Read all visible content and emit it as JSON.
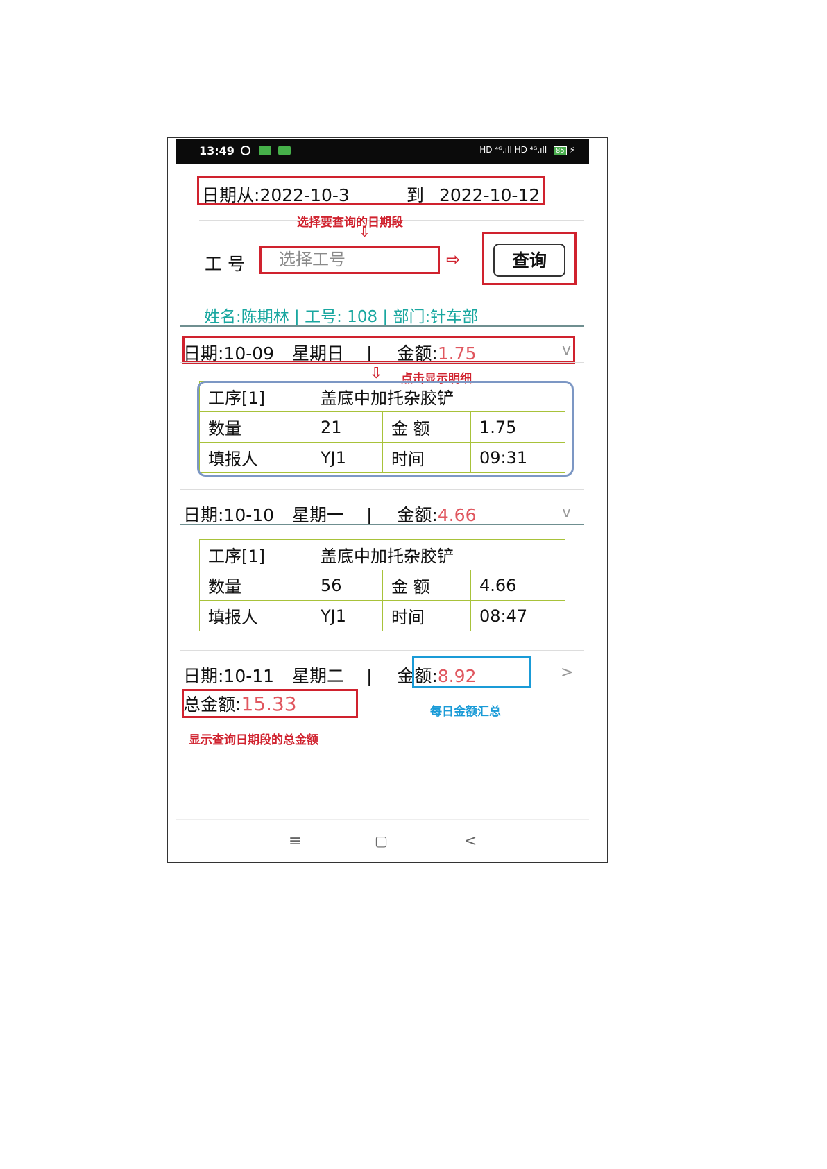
{
  "status_bar": {
    "time": "13:49",
    "signal": "HD ⁴ᴳ.ıll HD ⁴ᴳ.ıll",
    "battery": "85"
  },
  "date_range": {
    "from_label": "日期从:",
    "from": "2022-10-3",
    "to_label": "到",
    "to": "2022-10-12"
  },
  "annotations": {
    "select_date": "选择要查询的日期段",
    "click_detail": "点击显示明细",
    "daily_total": "每日金额汇总",
    "total_note": "显示查询日期段的总金额"
  },
  "employee": {
    "label": "工 号",
    "placeholder": "选择工号"
  },
  "query_button": "查询",
  "info": "姓名:陈期林 | 工号: 108 | 部门:针车部",
  "days": [
    {
      "date": "日期:10-09",
      "weekday": "星期日",
      "sep": "|",
      "amount_label": "金额:",
      "amount": "1.75",
      "chevron": "v"
    },
    {
      "date": "日期:10-10",
      "weekday": "星期一",
      "sep": "|",
      "amount_label": "金额:",
      "amount": "4.66",
      "chevron": "v"
    },
    {
      "date": "日期:10-11",
      "weekday": "星期二",
      "sep": "|",
      "amount_label": "金额:",
      "amount": "8.92",
      "chevron": ">"
    }
  ],
  "details": [
    {
      "process_label": "工序[1]",
      "process": "盖底中加托杂胶铲",
      "qty_label": "数量",
      "qty": "21",
      "amt_label": "金 额",
      "amt": "1.75",
      "reporter_label": "填报人",
      "reporter": "YJ1",
      "time_label": "时间",
      "time": "09:31"
    },
    {
      "process_label": "工序[1]",
      "process": "盖底中加托杂胶铲",
      "qty_label": "数量",
      "qty": "56",
      "amt_label": "金 额",
      "amt": "4.66",
      "reporter_label": "填报人",
      "reporter": "YJ1",
      "time_label": "时间",
      "time": "08:47"
    }
  ],
  "total": {
    "label": "总金额:",
    "value": "15.33"
  },
  "nav_bar": {
    "menu": "≡",
    "home": "▢",
    "back": "<"
  },
  "colors": {
    "annotation_red": "#d0222e",
    "annotation_blue": "#1a9bd7",
    "amount_red": "#e0575f",
    "info_teal": "#19a7a0",
    "table_border": "#a8c23a"
  }
}
